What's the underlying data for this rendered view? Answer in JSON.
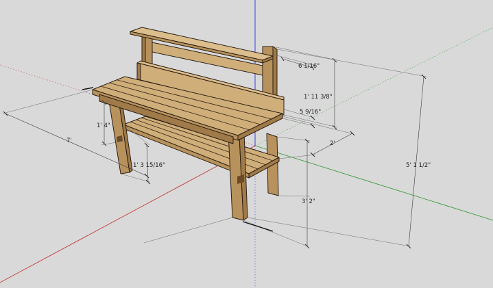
{
  "colors": {
    "background": "#d9d9d9",
    "axis_red": "#c23b3b",
    "axis_green": "#3a9a3a",
    "axis_blue": "#2a2ae0",
    "wood": "#cfae7a"
  },
  "dimensions": {
    "d_6_1_16": "6 1/16\"",
    "d_1_11_3_8": "1' 11 3/8\"",
    "d_5_9_16": "5 9/16\"",
    "d_2": "2'",
    "d_1_4": "1' 4\"",
    "d_7": "7'",
    "d_1_3_15_16": "1' 3 15/16\"",
    "d_3_2": "3' 2\"",
    "d_5_1_1_2": "5' 1 1/2\""
  }
}
